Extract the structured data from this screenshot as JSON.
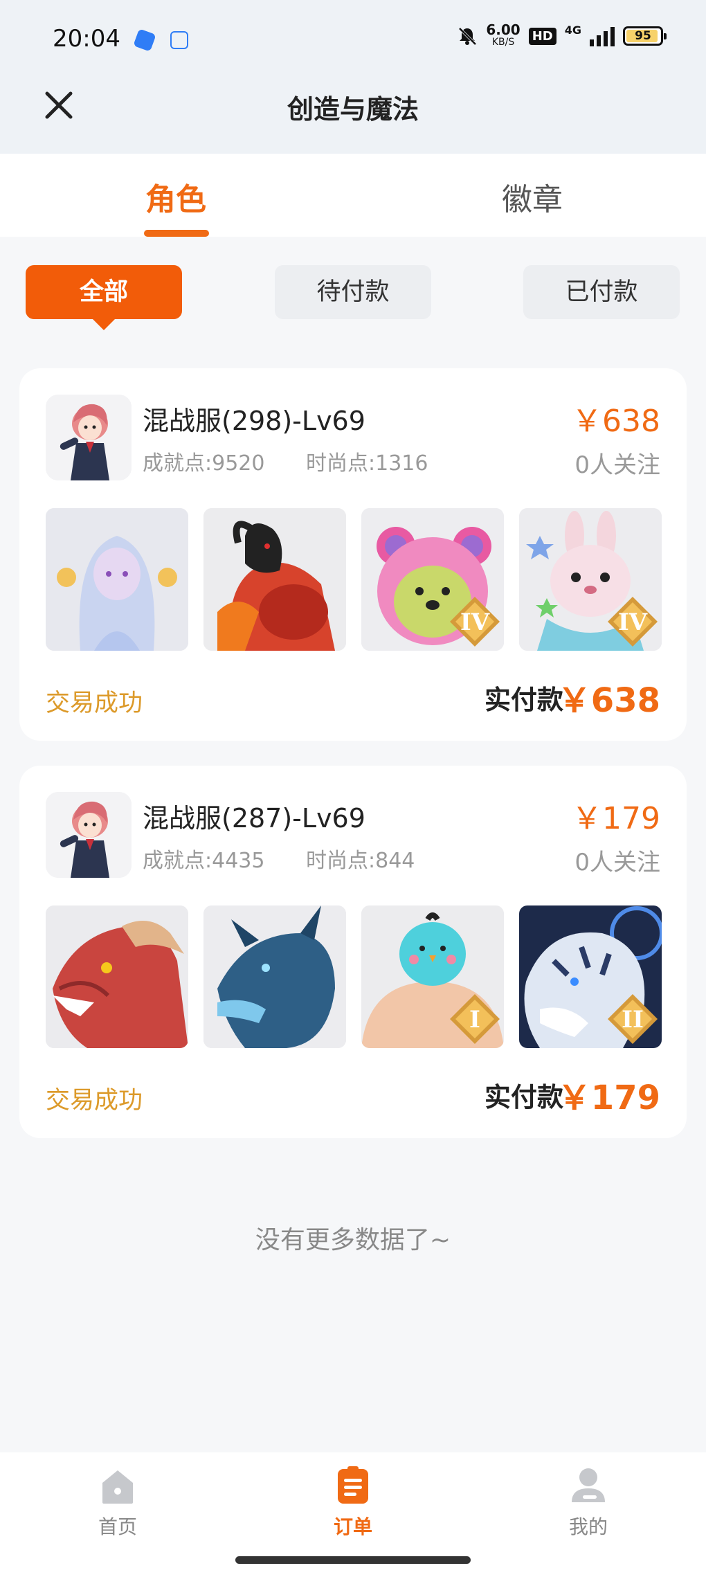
{
  "status_bar": {
    "time": "20:04",
    "speed_value": "6.00",
    "speed_unit": "KB/S",
    "hd": "HD",
    "network": "4G",
    "battery": "95",
    "battery_level": 0.95
  },
  "nav": {
    "title": "创造与魔法",
    "close_icon": "close-icon"
  },
  "tabs": [
    {
      "label": "角色",
      "active": true
    },
    {
      "label": "徽章",
      "active": false
    }
  ],
  "filters": [
    {
      "label": "全部",
      "active": true
    },
    {
      "label": "待付款",
      "active": false
    },
    {
      "label": "已付款",
      "active": false
    }
  ],
  "orders": [
    {
      "title": "混战服(298)-Lv69",
      "achievement": "成就点:9520",
      "fashion": "时尚点:1316",
      "price": "￥638",
      "followers": "0人关注",
      "status": "交易成功",
      "paid_label": "实付款",
      "paid_amount": "￥638",
      "items": [
        {
          "name": "ice-fairy-image"
        },
        {
          "name": "black-goat-beast-image"
        },
        {
          "name": "pink-bear-image",
          "badge": "IV"
        },
        {
          "name": "pink-rabbit-image",
          "badge": "IV"
        }
      ]
    },
    {
      "title": "混战服(287)-Lv69",
      "achievement": "成就点:4435",
      "fashion": "时尚点:844",
      "price": "￥179",
      "followers": "0人关注",
      "status": "交易成功",
      "paid_label": "实付款",
      "paid_amount": "￥179",
      "items": [
        {
          "name": "red-dragon-image"
        },
        {
          "name": "blue-dragon-image"
        },
        {
          "name": "muscle-bird-image",
          "badge": "I"
        },
        {
          "name": "white-tiger-image",
          "badge": "II"
        }
      ]
    }
  ],
  "list_end": "没有更多数据了~",
  "bottom_nav": [
    {
      "label": "首页",
      "icon": "home-icon",
      "active": false
    },
    {
      "label": "订单",
      "icon": "order-icon",
      "active": true
    },
    {
      "label": "我的",
      "icon": "profile-icon",
      "active": false
    }
  ],
  "colors": {
    "accent": "#f06a14",
    "status": "#dc9a2a",
    "active_filter": "#f25c09"
  }
}
